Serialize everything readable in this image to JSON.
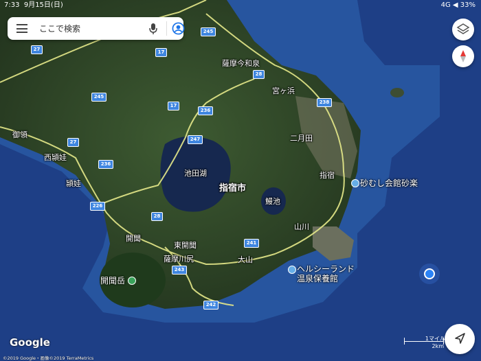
{
  "status_bar": {
    "time": "7:33",
    "date": "9月15日(日)",
    "right": "4G ◀ 33%"
  },
  "search": {
    "placeholder": "ここで検索"
  },
  "roads": [
    "245",
    "27",
    "17",
    "245",
    "17",
    "236",
    "28",
    "238",
    "27",
    "236",
    "247",
    "226",
    "28",
    "241",
    "243",
    "242"
  ],
  "place_labels": {
    "sako_imaizumi": "薩摩今和泉",
    "miyagahama": "宮ヶ浜",
    "futatsukida": "二月田",
    "gorou": "御領",
    "nishiengou": "西頴娃",
    "engou": "頴娃",
    "ikedako": "池田湖",
    "ibusuki_city": "指宿市",
    "ibusuki": "指宿",
    "unagiike": "鰻池",
    "yamakawa": "山川",
    "kaimon": "開聞",
    "higashikaimon": "東開聞",
    "satsuma_kawajiri": "薩摩川尻",
    "oyama": "大山"
  },
  "pois": {
    "kaimondake": "開聞岳",
    "sunamushi": "砂むし会館砂楽",
    "healthy_land": "ヘルシーランド 温泉保養館"
  },
  "attribution": {
    "google": "Google",
    "copyright": "©2019 Google・画像©2019 TerraMetrics"
  },
  "scale": {
    "miles": "1マイル",
    "km": "2km"
  },
  "colors": {
    "sea_deep": "#1e3f86",
    "sea_shallow": "#2f67b4",
    "land": "#2f4a2a",
    "road": "#e6e98a",
    "shield": "#3f86e0"
  }
}
